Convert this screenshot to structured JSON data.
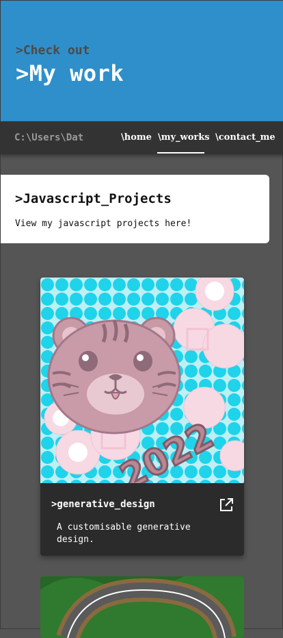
{
  "hero": {
    "subtitle": ">Check out",
    "title": ">My work"
  },
  "nav": {
    "path": "C:\\Users\\Dat",
    "links": [
      {
        "label": "\\home"
      },
      {
        "label": "\\my_works",
        "active": true
      },
      {
        "label": "\\contact_me"
      }
    ]
  },
  "intro": {
    "title": ">Javascript_Projects",
    "text": "View my javascript projects here!"
  },
  "projects": [
    {
      "title": ">generative_design",
      "description": "A customisable generative design.",
      "image_text": "2022",
      "link_icon": "external-link-icon"
    }
  ],
  "colors": {
    "hero_bg": "#2f8fca",
    "nav_bg": "#333333",
    "page_bg": "#555555",
    "card_bg": "#2b2b2b"
  }
}
